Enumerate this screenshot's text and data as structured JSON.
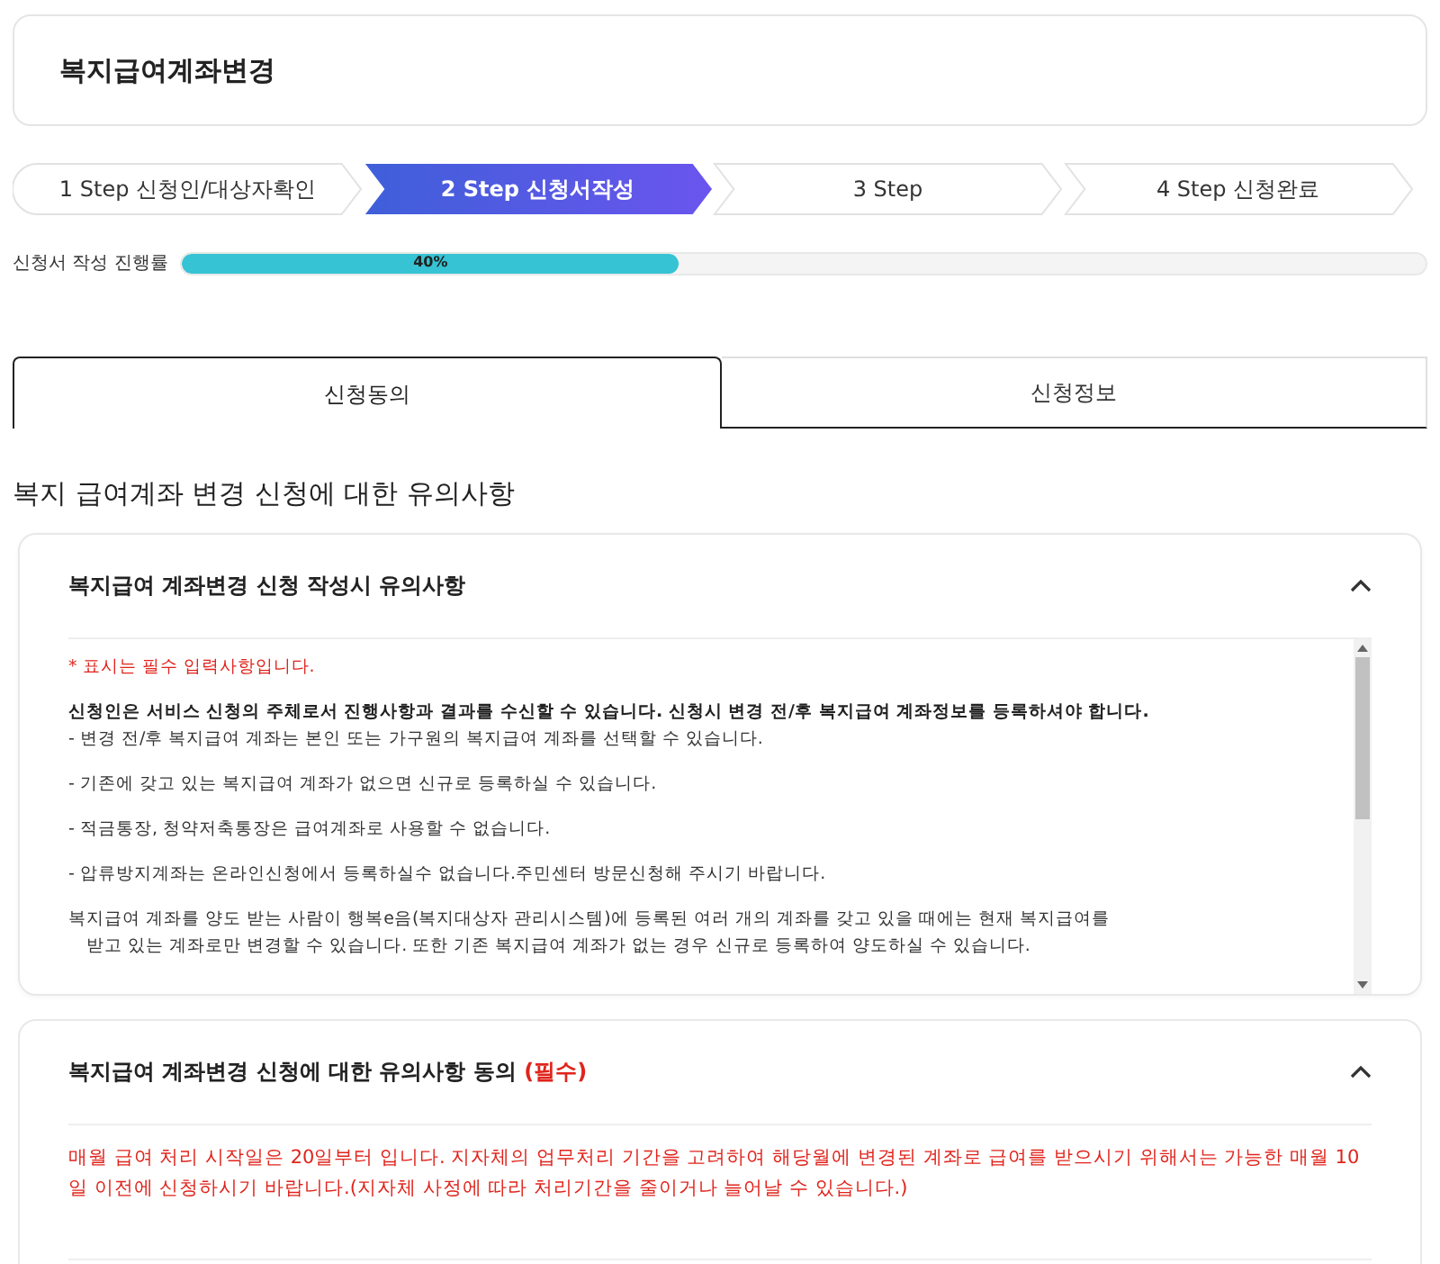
{
  "page_title": "복지급여계좌변경",
  "steps": [
    {
      "label": "1 Step 신청인/대상자확인",
      "selected": false
    },
    {
      "label": "2 Step 신청서작성",
      "selected": true
    },
    {
      "label": "3 Step",
      "selected": false
    },
    {
      "label": "4 Step 신청완료",
      "selected": false
    }
  ],
  "progress": {
    "label": "신청서 작성 진행률",
    "level": 0.4,
    "reading": "40%"
  },
  "tabs": [
    {
      "label": "신청동의",
      "selected": true
    },
    {
      "label": "신청정보",
      "selected": false
    }
  ],
  "section_heading": "복지 급여계좌 변경 신청에 대한 유의사항",
  "notice_card": {
    "title": "복지급여 계좌변경 신청 작성시 유의사항",
    "expanded": true,
    "paragraphs": [
      {
        "kind": "required-note",
        "text": "* 표시는 필수 입력사항입니다."
      },
      {
        "kind": "bold",
        "text": "신청인은 서비스 신청의 주체로서 진행사항과 결과를 수신할 수 있습니다. 신청시 변경 전/후 복지급여 계좌정보를 등록하셔야 합니다."
      },
      {
        "kind": "continuation",
        "text": "- 변경 전/후 복지급여 계좌는 본인 또는 가구원의 복지급여 계좌를 선택할 수 있습니다."
      },
      {
        "kind": "text",
        "text": "- 기존에 갖고 있는 복지급여 계좌가 없으면 신규로 등록하실 수 있습니다."
      },
      {
        "kind": "text",
        "text": "- 적금통장, 청약저축통장은 급여계좌로 사용할 수 없습니다."
      },
      {
        "kind": "text",
        "text": "- 압류방지계좌는 온라인신청에서 등록하실수 없습니다.주민센터 방문신청해 주시기 바랍니다."
      },
      {
        "kind": "wrapped",
        "text": "복지급여 계좌를 양도 받는 사람이 행복e음(복지대상자 관리시스템)에 등록된 여러 개의 계좌를 갖고 있을 때에는 현재 복지급여를"
      },
      {
        "kind": "indented",
        "text": "받고 있는 계좌로만 변경할 수 있습니다. 또한 기존 복지급여 계좌가 없는 경우 신규로 등록하여 양도하실 수 있습니다."
      }
    ]
  },
  "agreement_card": {
    "title": "복지급여 계좌변경 신청에 대한 유의사항 동의",
    "required_mark": "(필수)",
    "expanded": true,
    "text": "매월 급여 처리 시작일은 20일부터 입니다. 지자체의 업무처리 기간을 고려하여 해당월에 변경된 계좌로 급여를 받으시기 위해서는 가능한 매월 10일 이전에 신청하시기 바랍니다.(지자체 사정에 따라 처리기간을 줄이거나 늘어날 수 있습니다.)"
  }
}
